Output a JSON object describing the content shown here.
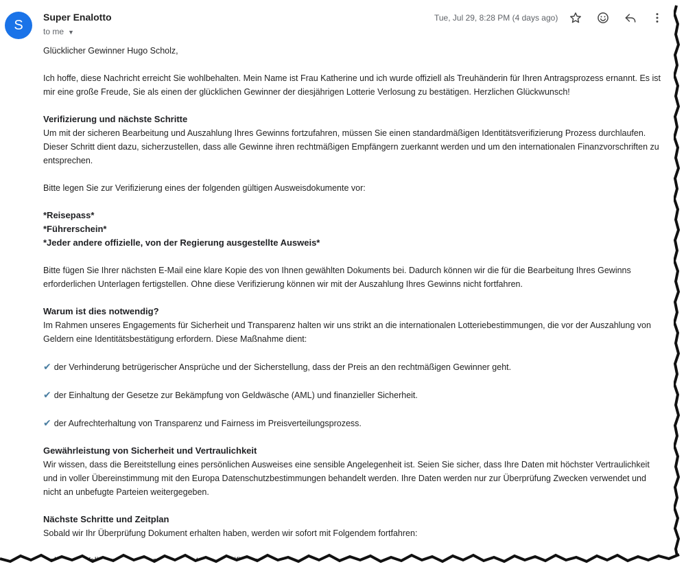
{
  "header": {
    "avatar_letter": "S",
    "sender": "Super Enalotto",
    "recipient": "to me",
    "date": "Tue, Jul 29, 8:28 PM (4 days ago)"
  },
  "email": {
    "greeting": "Glücklicher Gewinner  Hugo Scholz,",
    "intro": "Ich hoffe, diese Nachricht erreicht Sie wohlbehalten. Mein Name ist Frau Katherine und ich wurde offiziell als Treuhänderin für Ihren Antragsprozess ernannt. Es ist mir eine große Freude, Sie als einen der glücklichen Gewinner der diesjährigen Lotterie Verlosung zu bestätigen. Herzlichen Glückwunsch!",
    "heading_verification": "Verifizierung und nächste Schritte",
    "verification_text": "Um mit der sicheren Bearbeitung und Auszahlung Ihres Gewinns fortzufahren, müssen Sie einen standardmäßigen Identitätsverifizierung Prozess durchlaufen. Dieser Schritt dient dazu, sicherzustellen, dass alle Gewinne ihren rechtmäßigen Empfängern zuerkannt werden und um den internationalen Finanzvorschriften zu entsprechen.",
    "documents_intro": "Bitte legen Sie zur Verifizierung eines der folgenden gültigen Ausweisdokumente vor:",
    "documents": [
      "*Reisepass*",
      "*Führerschein*",
      "*Jeder andere offizielle, von der Regierung ausgestellte Ausweis*"
    ],
    "attach_text": "Bitte fügen Sie Ihrer nächsten E-Mail eine klare Kopie des von Ihnen gewählten Dokuments bei. Dadurch können wir die für die Bearbeitung Ihres Gewinns erforderlichen Unterlagen fertigstellen. Ohne diese Verifizierung können wir mit der Auszahlung Ihres Gewinns nicht fortfahren.",
    "heading_why": "Warum ist dies notwendig?",
    "why_text": "Im Rahmen unseres Engagements für Sicherheit und Transparenz halten wir uns strikt an die internationalen Lotteriebestimmungen, die vor der Auszahlung von Geldern eine Identitätsbestätigung erfordern. Diese Maßnahme dient:",
    "reasons": [
      "der Verhinderung betrügerischer Ansprüche und der Sicherstellung, dass der Preis an den rechtmäßigen Gewinner geht.",
      "der Einhaltung der Gesetze zur Bekämpfung von Geldwäsche (AML) und finanzieller Sicherheit.",
      "der Aufrechterhaltung von Transparenz und Fairness im Preisverteilungsprozess."
    ],
    "heading_security": "Gewährleistung von Sicherheit und Vertraulichkeit",
    "security_text": "Wir wissen, dass die Bereitstellung eines persönlichen Ausweises eine sensible Angelegenheit ist. Seien Sie sicher, dass Ihre Daten mit höchster Vertraulichkeit und in voller Übereinstimmung mit den Europa Datenschutzbestimmungen behandelt werden. Ihre Daten werden nur zur Überprüfung Zwecken verwendet und nicht an unbefugte Parteien weitergegeben.",
    "heading_next": "Nächste Schritte und Zeitplan",
    "next_text": "Sobald wir Ihr Überprüfung Dokument erhalten haben, werden wir sofort mit Folgendem fortfahren:",
    "cut_line": "Dokument Validierung ... überprüften Daten ... zertifizieren."
  },
  "colors": {
    "avatar": "#1a73e8",
    "check": "#4a7ea1"
  },
  "icons": [
    "star-icon",
    "emoji-icon",
    "reply-icon",
    "more-vert-icon",
    "chevron-down-icon",
    "check-icon"
  ]
}
